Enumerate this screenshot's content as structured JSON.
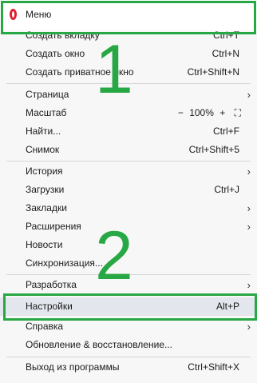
{
  "menu": {
    "title": "Меню",
    "items": [
      {
        "label": "Создать вкладку",
        "shortcut": "Ctrl+T",
        "chevron": ""
      },
      {
        "label": "Создать окно",
        "shortcut": "Ctrl+N",
        "chevron": ""
      },
      {
        "label": "Создать приватное окно",
        "shortcut": "Ctrl+Shift+N",
        "chevron": ""
      },
      {
        "label": "Страница",
        "shortcut": "",
        "chevron": "›"
      },
      {
        "label": "Масштаб",
        "shortcut": "",
        "chevron": ""
      },
      {
        "label": "Найти...",
        "shortcut": "Ctrl+F",
        "chevron": ""
      },
      {
        "label": "Снимок",
        "shortcut": "Ctrl+Shift+5",
        "chevron": ""
      },
      {
        "label": "История",
        "shortcut": "",
        "chevron": "›"
      },
      {
        "label": "Загрузки",
        "shortcut": "Ctrl+J",
        "chevron": ""
      },
      {
        "label": "Закладки",
        "shortcut": "",
        "chevron": "›"
      },
      {
        "label": "Расширения",
        "shortcut": "",
        "chevron": "›"
      },
      {
        "label": "Новости",
        "shortcut": "",
        "chevron": ""
      },
      {
        "label": "Синхронизация...",
        "shortcut": "",
        "chevron": ""
      },
      {
        "label": "Разработка",
        "shortcut": "",
        "chevron": "›"
      },
      {
        "label": "Настройки",
        "shortcut": "Alt+P",
        "chevron": ""
      },
      {
        "label": "Справка",
        "shortcut": "",
        "chevron": "›"
      },
      {
        "label": "Обновление & восстановление...",
        "shortcut": "",
        "chevron": ""
      },
      {
        "label": "Выход из программы",
        "shortcut": "Ctrl+Shift+X",
        "chevron": ""
      }
    ],
    "zoom": {
      "minus": "−",
      "value": "100%",
      "plus": "+",
      "fullscreen": "⛶"
    }
  },
  "annotations": {
    "one": "1",
    "two": "2"
  },
  "colors": {
    "annotation": "#28a745",
    "opera_logo": "#e51a2e",
    "highlight": "#e3e6ec"
  }
}
